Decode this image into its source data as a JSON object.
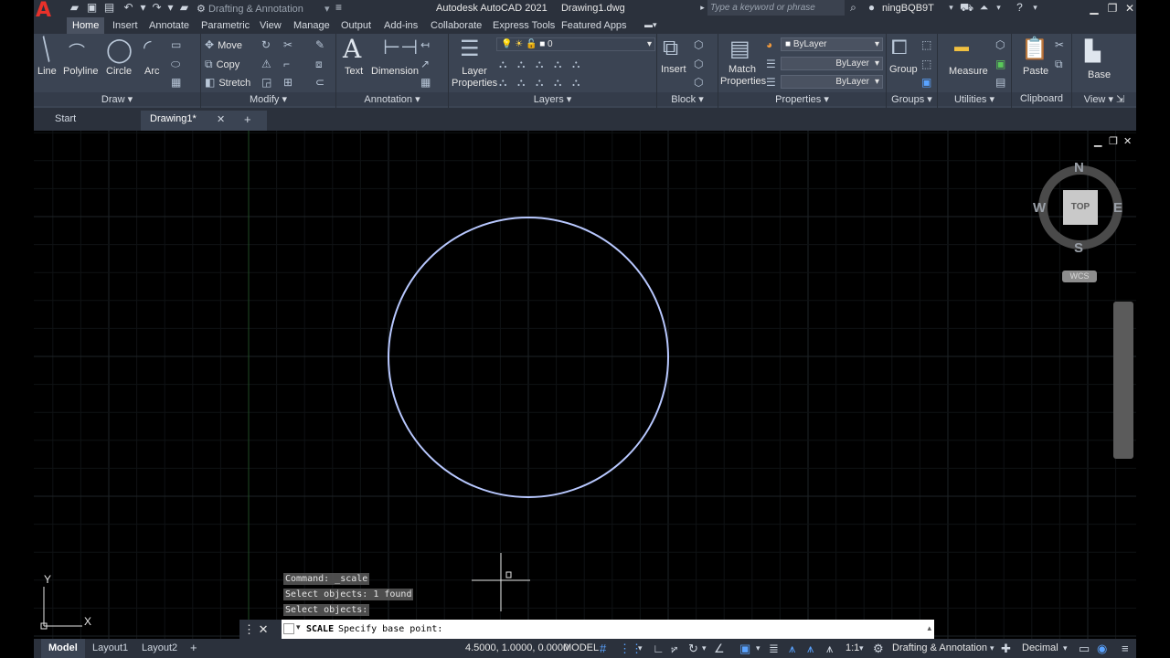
{
  "app": {
    "title": "Autodesk AutoCAD 2021",
    "file": "Drawing1.dwg",
    "workspace": "Drafting & Annotation",
    "search_placeholder": "Type a keyword or phrase",
    "user": "ningBQB9T"
  },
  "ribbon_tabs": [
    "Home",
    "Insert",
    "Annotate",
    "Parametric",
    "View",
    "Manage",
    "Output",
    "Add-ins",
    "Collaborate",
    "Express Tools",
    "Featured Apps"
  ],
  "ribbon": {
    "draw": {
      "title": "Draw",
      "line": "Line",
      "polyline": "Polyline",
      "circle": "Circle",
      "arc": "Arc"
    },
    "modify": {
      "title": "Modify",
      "move": "Move",
      "copy": "Copy",
      "stretch": "Stretch"
    },
    "annotation": {
      "title": "Annotation",
      "text": "Text",
      "dimension": "Dimension"
    },
    "layers": {
      "title": "Layers",
      "layer_properties": "Layer Properties",
      "current_layer": "0"
    },
    "block": {
      "title": "Block",
      "insert": "Insert"
    },
    "properties": {
      "title": "Properties",
      "match_properties": "Match Properties",
      "color": "ByLayer",
      "linetype": "ByLayer",
      "lineweight": "ByLayer"
    },
    "groups": {
      "title": "Groups",
      "group": "Group"
    },
    "utilities": {
      "title": "Utilities",
      "measure": "Measure"
    },
    "clipboard": {
      "title": "Clipboard",
      "paste": "Paste"
    },
    "view": {
      "title": "View",
      "base": "Base"
    }
  },
  "file_tabs": {
    "start": "Start",
    "drawing": "Drawing1*"
  },
  "viewcube": {
    "n": "N",
    "s": "S",
    "e": "E",
    "w": "W",
    "face": "TOP",
    "ucs": "WCS"
  },
  "ucs_icon": {
    "x": "X",
    "y": "Y"
  },
  "command_history": [
    "Command: _scale",
    "Select objects: 1 found",
    "Select objects:"
  ],
  "command_line": {
    "command": "SCALE",
    "prompt": "Specify base point:"
  },
  "status": {
    "tabs": [
      "Model",
      "Layout1",
      "Layout2"
    ],
    "coordinates": "4.5000, 1.0000, 0.0000",
    "space": "MODEL",
    "scale": "1:1",
    "workspace": "Drafting & Annotation",
    "units": "Decimal"
  },
  "colors": {
    "accent": "#5aa3ff",
    "circle": "#b8c8ff",
    "logo": "#e8312a"
  }
}
